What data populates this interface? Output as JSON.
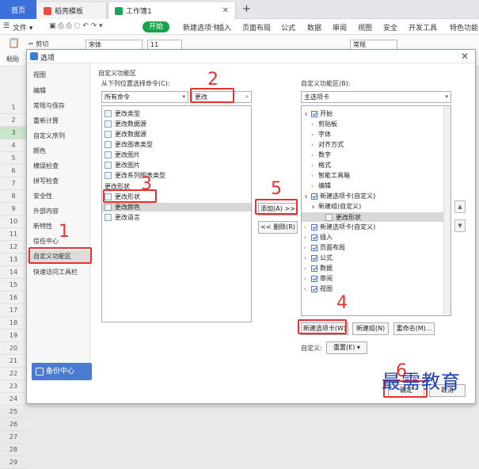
{
  "tabs": [
    {
      "label": "首页"
    },
    {
      "label": "稻壳模板"
    },
    {
      "label": "工作簿1"
    }
  ],
  "ribbon": {
    "file": "文件",
    "start": "开始",
    "items": [
      "新建选项卡",
      "插入",
      "页面布局",
      "公式",
      "数据",
      "审阅",
      "视图",
      "安全",
      "开发工具",
      "特色功能"
    ]
  },
  "toolbar": {
    "cut": "剪切",
    "paste": "粘贴",
    "font": "宋体",
    "size": "11",
    "format": "常规"
  },
  "rows": [
    "1",
    "2",
    "3",
    "4",
    "5",
    "6",
    "7",
    "8",
    "9",
    "10",
    "11",
    "12",
    "13",
    "14",
    "15",
    "16",
    "17",
    "18",
    "19",
    "20",
    "21",
    "22",
    "23",
    "24",
    "25",
    "26",
    "27",
    "28",
    "29"
  ],
  "dialog": {
    "title": "选项",
    "nav": [
      "视图",
      "编辑",
      "常规与保存",
      "重新计算",
      "自定义序列",
      "颜色",
      "横误检查",
      "拼写检查",
      "安全性",
      "外部内容",
      "新特性",
      "信任中心",
      "自定义功能区",
      "快速访问工具栏"
    ],
    "section_title": "自定义功能区",
    "from_label": "从下列位置选择命令(C):",
    "from_value": "所有命令",
    "search_value": "更改",
    "commands": [
      "更改类型",
      "更改数据源",
      "更改数据源",
      "更改图表类型",
      "更改图片",
      "更改图片",
      "更改系列图表类型",
      "更改形状"
    ],
    "group_label": "更改形状",
    "commands2": [
      "更改形状",
      "更改颜色",
      "更改语言"
    ],
    "add_button": "添加(A) >>",
    "remove_button": "<< 删除(R)",
    "right_label": "自定义功能区(B):",
    "right_value": "主选项卡",
    "tree": [
      {
        "label": "开始",
        "level": 0,
        "checked": true,
        "expanded": true
      },
      {
        "label": "剪贴板",
        "level": 1
      },
      {
        "label": "字体",
        "level": 1
      },
      {
        "label": "对齐方式",
        "level": 1
      },
      {
        "label": "数字",
        "level": 1
      },
      {
        "label": "格式",
        "level": 1
      },
      {
        "label": "智能工具箱",
        "level": 1
      },
      {
        "label": "编辑",
        "level": 1
      },
      {
        "label": "新建选项卡(自定义)",
        "level": 0,
        "checked": true,
        "expanded": true
      },
      {
        "label": "新建组(自定义)",
        "level": 1,
        "expanded": true
      },
      {
        "label": "更改形状",
        "level": 2
      },
      {
        "label": "新建选项卡(自定义)",
        "level": 0,
        "checked": true
      },
      {
        "label": "插入",
        "level": 0,
        "checked": true
      },
      {
        "label": "页面布局",
        "level": 0,
        "checked": true
      },
      {
        "label": "公式",
        "level": 0,
        "checked": true
      },
      {
        "label": "数据",
        "level": 0,
        "checked": true
      },
      {
        "label": "审阅",
        "level": 0,
        "checked": true
      },
      {
        "label": "视图",
        "level": 0,
        "checked": true
      }
    ],
    "new_tab_button": "新建选项卡(W)",
    "new_group_button": "新建组(N)",
    "rename_button": "重命名(M)...",
    "custom_label": "自定义:",
    "reset_button": "重置(E)",
    "backup": "备份中心",
    "ok_button": "确定",
    "cancel_button": "取消"
  },
  "annotations": [
    "1",
    "2",
    "3",
    "4",
    "5",
    "6"
  ],
  "watermark": "最需教育",
  "colors": {
    "annotation": "#e5322d",
    "accent": "#3b6fd9",
    "start": "#16a34a"
  }
}
